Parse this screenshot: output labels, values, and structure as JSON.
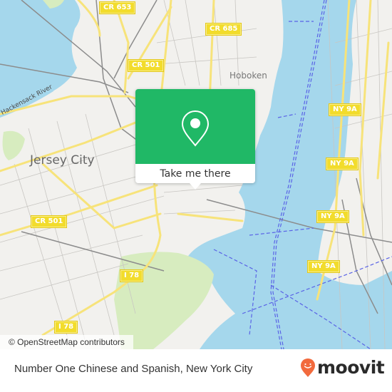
{
  "map": {
    "colors": {
      "land": "#f2f1ee",
      "water": "#a5d7ec",
      "park": "#d7ecbf",
      "road_major": "#f7e37a",
      "road_minor": "#c8c6c2",
      "rail": "#8c8c8c",
      "ferry": "#5a63e6"
    },
    "place_labels": {
      "jersey_city": "Jersey City",
      "hoboken": "Hoboken",
      "hackensack_river": "Hackensack River"
    },
    "route_shields": [
      {
        "id": "cr653",
        "label": "CR 653"
      },
      {
        "id": "cr685",
        "label": "CR 685"
      },
      {
        "id": "cr501a",
        "label": "CR 501"
      },
      {
        "id": "cr501b",
        "label": "CR 501"
      },
      {
        "id": "ny9a1",
        "label": "NY 9A"
      },
      {
        "id": "ny9a2",
        "label": "NY 9A"
      },
      {
        "id": "ny9a3",
        "label": "NY 9A"
      },
      {
        "id": "ny9a4",
        "label": "NY 9A"
      },
      {
        "id": "i78a",
        "label": "I 78"
      },
      {
        "id": "i78b",
        "label": "I 78"
      }
    ]
  },
  "popup": {
    "accent_color": "#20b866",
    "icon": "map-pin-icon",
    "button_label": "Take me there"
  },
  "attribution": "© OpenStreetMap contributors",
  "footer": {
    "title": "Number One Chinese and Spanish, New York City",
    "brand": "moovit",
    "brand_color": "#f26a3d"
  }
}
